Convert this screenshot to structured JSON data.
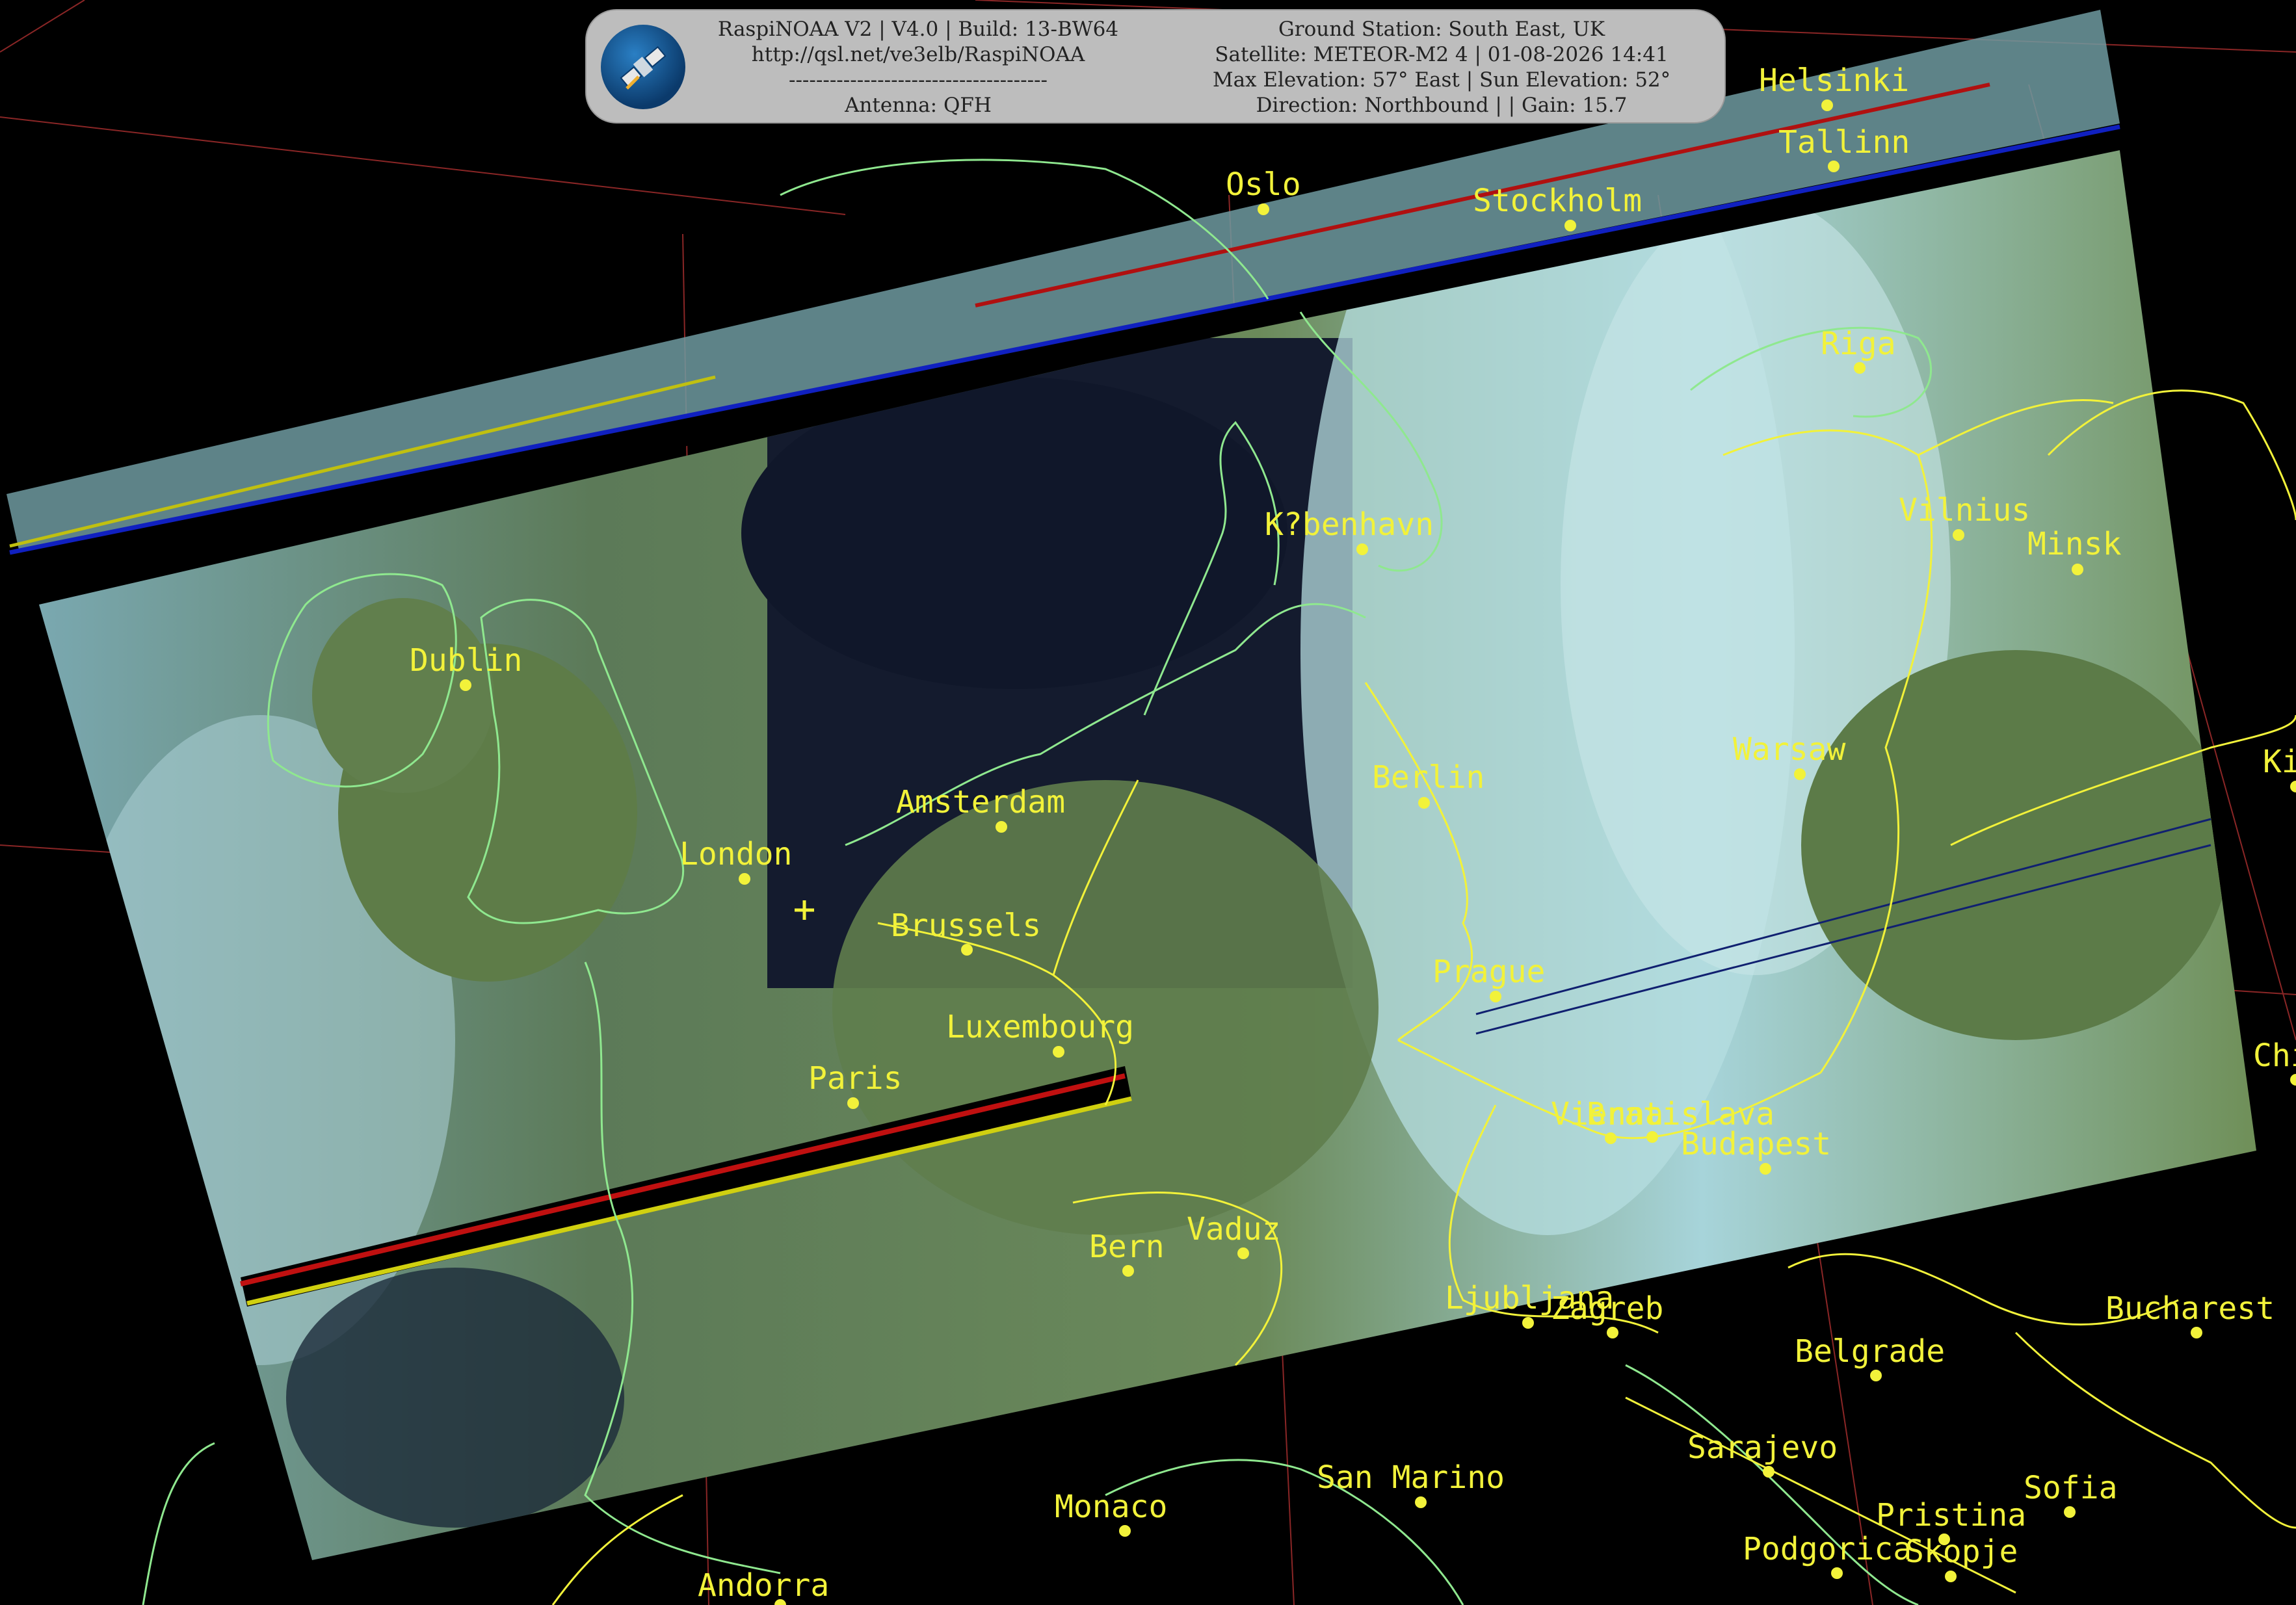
{
  "info": {
    "line1_left": "RaspiNOAA V2 | V4.0 | Build: 13-BW64",
    "line2_left": "http://qsl.net/ve3elb/RaspiNOAA",
    "line3_left": "--------------------------------------",
    "line4_left": "Antenna: QFH",
    "line1_right": "Ground Station: South East, UK",
    "line2_right": "Satellite: METEOR-M2 4 | 01-08-2026 14:41",
    "line3_right": "Max Elevation: 57° East | Sun Elevation: 52°",
    "line4_right": "Direction: Northbound | | Gain: 15.7"
  },
  "logo_icon": "satellite-icon",
  "colors": {
    "label": "#f2f23a",
    "border": "#f2f23a",
    "coast": "#8fe88f",
    "grid": "#b03030"
  },
  "cities": [
    {
      "name": "Helsinki"
    },
    {
      "name": "Tallinn"
    },
    {
      "name": "Oslo"
    },
    {
      "name": "Stockholm"
    },
    {
      "name": "Riga"
    },
    {
      "name": "K?benhavn"
    },
    {
      "name": "Vilnius"
    },
    {
      "name": "Minsk"
    },
    {
      "name": "Dublin"
    },
    {
      "name": "Amsterdam"
    },
    {
      "name": "Berlin"
    },
    {
      "name": "Warsaw"
    },
    {
      "name": "London"
    },
    {
      "name": "Brussels"
    },
    {
      "name": "Prague"
    },
    {
      "name": "Luxembourg"
    },
    {
      "name": "Paris"
    },
    {
      "name": "Vienna"
    },
    {
      "name": "Bratislava"
    },
    {
      "name": "Budapest"
    },
    {
      "name": "Bern"
    },
    {
      "name": "Vaduz"
    },
    {
      "name": "Ljubljana"
    },
    {
      "name": "Zagreb"
    },
    {
      "name": "Belgrade"
    },
    {
      "name": "Bucharest"
    },
    {
      "name": "Sarajevo"
    },
    {
      "name": "San Marino"
    },
    {
      "name": "Monaco"
    },
    {
      "name": "Sofia"
    },
    {
      "name": "Pristina"
    },
    {
      "name": "Podgorica"
    },
    {
      "name": "Skopje"
    },
    {
      "name": "Andorra"
    },
    {
      "name": "Ki"
    },
    {
      "name": "Chis"
    }
  ]
}
